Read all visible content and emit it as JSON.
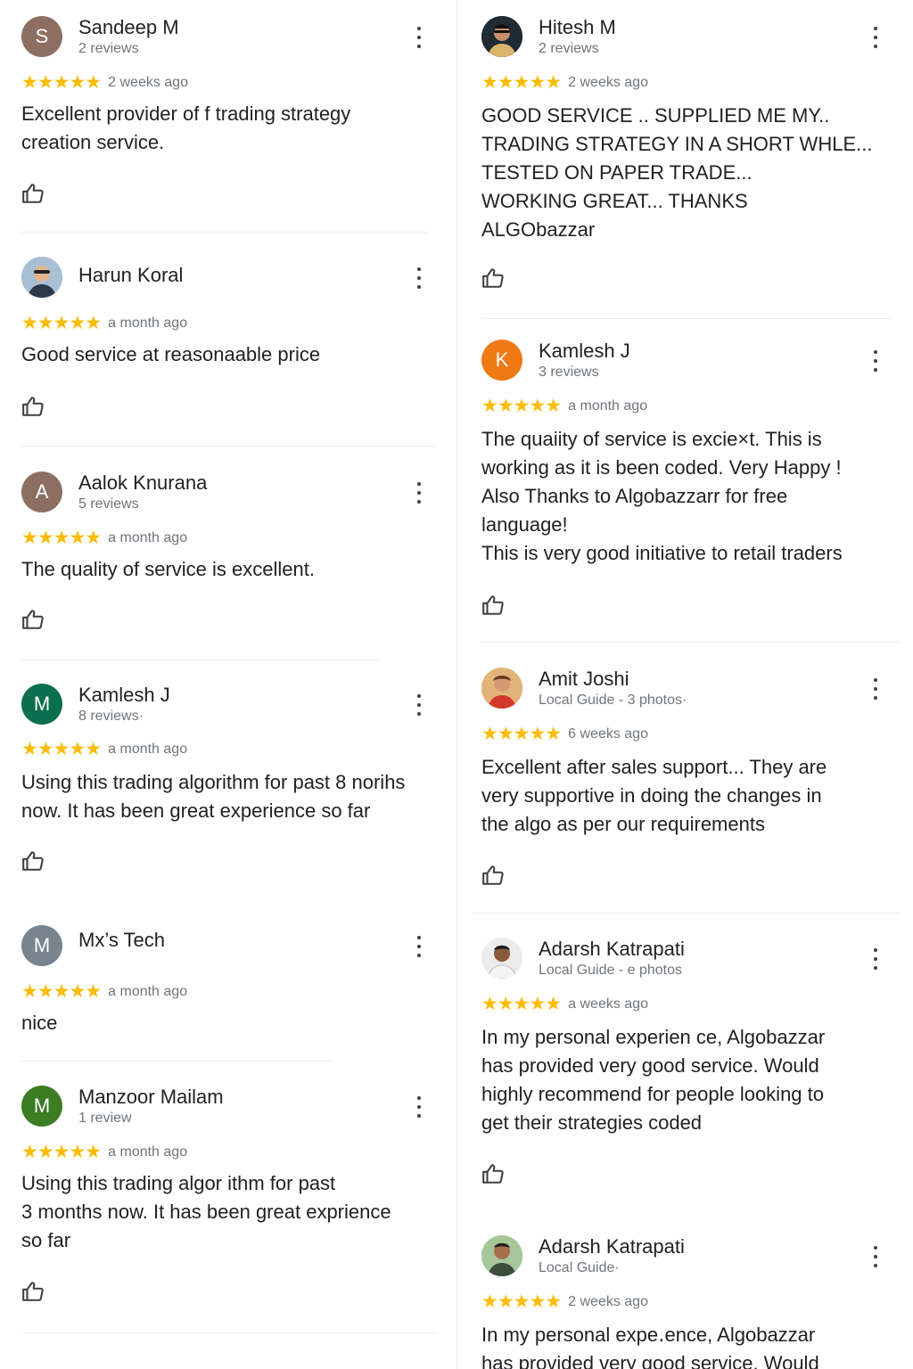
{
  "colors": {
    "star": "#fbbc04",
    "text": "#202124",
    "secondary": "#70757a",
    "avatar_brown": "#8d6e63",
    "avatar_green": "#0b6e4f",
    "avatar_gray": "#78848e",
    "avatar_olive": "#3b7d23",
    "avatar_orange": "#ef7a14"
  },
  "left_reviews": [
    {
      "name": "Sandeep M",
      "meta": "2 reviews",
      "initial": "S",
      "stars": "★★★★★",
      "date": "2 weeks ago",
      "text": "Excellent provider of f trading strategy\ncreation service.",
      "avatar_icon": "letter-avatar"
    },
    {
      "name": "Harun Koral",
      "meta": "",
      "initial": "",
      "stars": "★★★★★",
      "date": "a month ago",
      "text": "Good service at reasonaable price",
      "avatar_icon": "profile-photo"
    },
    {
      "name": "Aalok Knurana",
      "meta": "5 reviews",
      "initial": "A",
      "stars": "★★★★★",
      "date": "a month ago",
      "text": "The quality of  service is excellent.",
      "avatar_icon": "letter-avatar"
    },
    {
      "name": "Kamlesh J",
      "meta": "8 reviews·",
      "initial": "M",
      "stars": "★★★★★",
      "date": "a month ago",
      "text": "Using this trading algorithm for past 8 norihs\nnow. It has been great experience so far",
      "avatar_icon": "letter-avatar"
    },
    {
      "name": "Mx’s Tech",
      "meta": "",
      "initial": "M",
      "stars": "★★★★★",
      "date": "a month ago",
      "text": "nice",
      "avatar_icon": "letter-avatar"
    },
    {
      "name": "Manzoor Mailam",
      "meta": "1 review",
      "initial": "M",
      "stars": "★★★★★",
      "date": "a month ago",
      "text": "Using this trading algor ithm  for past\n3 months now. It has been great exprience\nso far",
      "avatar_icon": "letter-avatar"
    }
  ],
  "right_reviews": [
    {
      "name": "Hitesh M",
      "meta": "2 reviews",
      "initial": "",
      "stars": "★★★★★",
      "date": "2 weeks ago",
      "text": "GOOD SERVICE .. SUPPLIED ME MY..\nTRADING STRATEGY IN A SHORT WHLE...\nTESTED ON PAPER TRADE...\nWORKING GREAT...  THANKS\nALGObazzar",
      "avatar_icon": "profile-photo"
    },
    {
      "name": "Kamlesh J",
      "meta": "3 reviews",
      "initial": "K",
      "stars": "★★★★★",
      "date": "a month ago",
      "text": "The quaiity of service is excie×t. This is\nworking as it is been coded. Very Happy !\nAlso Thanks to Algobazzarr for free\nlanguage!\nThis is very good initiative to retail traders",
      "avatar_icon": "letter-avatar"
    },
    {
      "name": "Amit Joshi",
      "meta": "Local Guide - 3 photos·",
      "initial": "",
      "stars": "★★★★★",
      "date": "6 weeks ago",
      "text": "Excellent after sales support... They are\nvery supportive in doing the changes in\nthe algo as per our requirements",
      "avatar_icon": "profile-photo"
    },
    {
      "name": "Adarsh Katrapati",
      "meta": "Local Guide - e photos",
      "initial": "",
      "stars": "★★★★★",
      "date": "a weeks ago",
      "text": "In my personal experien ce, Algobazzar\nhas provided very good service. Would\nhighly recommend for people looking to\nget their strategies coded",
      "avatar_icon": "profile-photo"
    },
    {
      "name": "Adarsh Katrapati",
      "meta": "Local Guide·",
      "initial": "",
      "stars": "★★★★★",
      "date": "2 weeks ago",
      "text": "In my personal expe․ence, Algobazzar\nhas provided very good service. Would",
      "avatar_icon": "profile-photo"
    }
  ]
}
